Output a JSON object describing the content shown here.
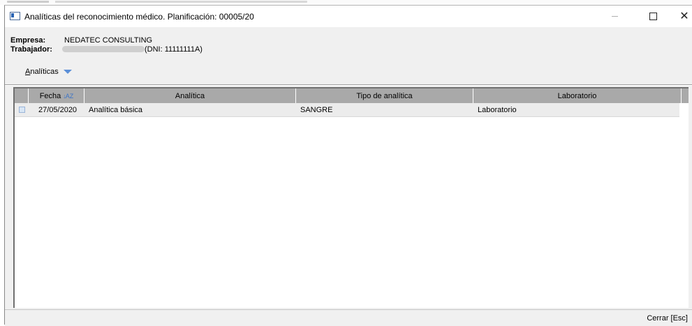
{
  "window": {
    "title": "Analíticas del reconocimiento médico. Planificación: 00005/20",
    "close_symbol": "✕"
  },
  "info": {
    "empresa_label": "Empresa:",
    "empresa_value": "NEDATEC CONSULTING",
    "trabajador_label": "Trabajador:",
    "trabajador_dni": "(DNI: 11111111A)"
  },
  "menu": {
    "analiticas_prefix": "A",
    "analiticas_rest": "nalíticas",
    "icon": "chevron-down-icon"
  },
  "table": {
    "columns": [
      "Fecha",
      "Analítica",
      "Tipo de analítica",
      "Laboratorio"
    ],
    "sort_glyph": "↓A Z",
    "rows": [
      {
        "fecha": "27/05/2020",
        "analitica": "Analítica básica",
        "tipo": "SANGRE",
        "laboratorio": "Laboratorio"
      }
    ]
  },
  "footer": {
    "close_label": "Cerrar  [Esc]"
  },
  "colors": {
    "header_bg": "#a9a9a9",
    "row_bg": "#ececec",
    "accent": "#5b8fd8"
  }
}
